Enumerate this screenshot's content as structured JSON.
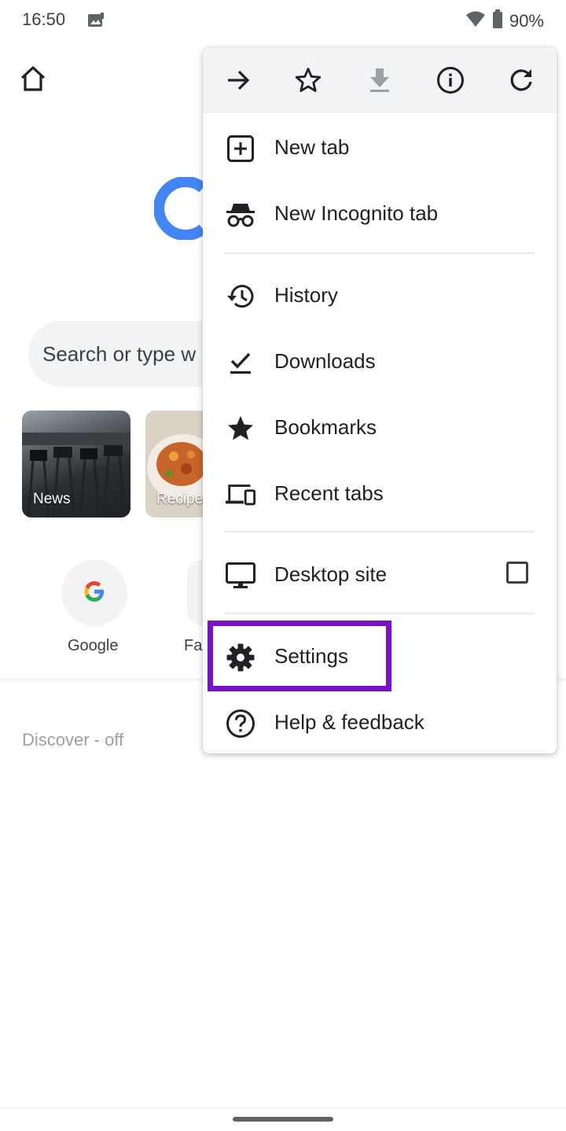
{
  "status_bar": {
    "time": "16:50",
    "battery": "90%"
  },
  "newtab": {
    "search_placeholder": "Search or type w",
    "tiles": [
      {
        "label": "News"
      },
      {
        "label": "Recipe"
      }
    ],
    "shortcuts": [
      {
        "label": "Google",
        "icon": "google-g-icon"
      },
      {
        "label": "Fa"
      }
    ],
    "discover_label": "Discover - off"
  },
  "menu": {
    "toolbar": [
      "forward-icon",
      "star-icon",
      "download-icon",
      "info-icon",
      "refresh-icon"
    ],
    "items": [
      {
        "label": "New tab",
        "icon": "new-tab-icon"
      },
      {
        "label": "New Incognito tab",
        "icon": "incognito-icon"
      },
      {
        "label": "History",
        "icon": "history-icon"
      },
      {
        "label": "Downloads",
        "icon": "downloads-icon"
      },
      {
        "label": "Bookmarks",
        "icon": "bookmarks-icon"
      },
      {
        "label": "Recent tabs",
        "icon": "recent-tabs-icon"
      },
      {
        "label": "Desktop site",
        "icon": "desktop-icon",
        "checked": false
      },
      {
        "label": "Settings",
        "icon": "gear-icon",
        "highlighted": true
      },
      {
        "label": "Help & feedback",
        "icon": "help-icon"
      }
    ]
  },
  "colors": {
    "highlight": "#7a10c8",
    "toolbar_bg": "#f1f3f4",
    "google_blue": "#4285f4"
  }
}
